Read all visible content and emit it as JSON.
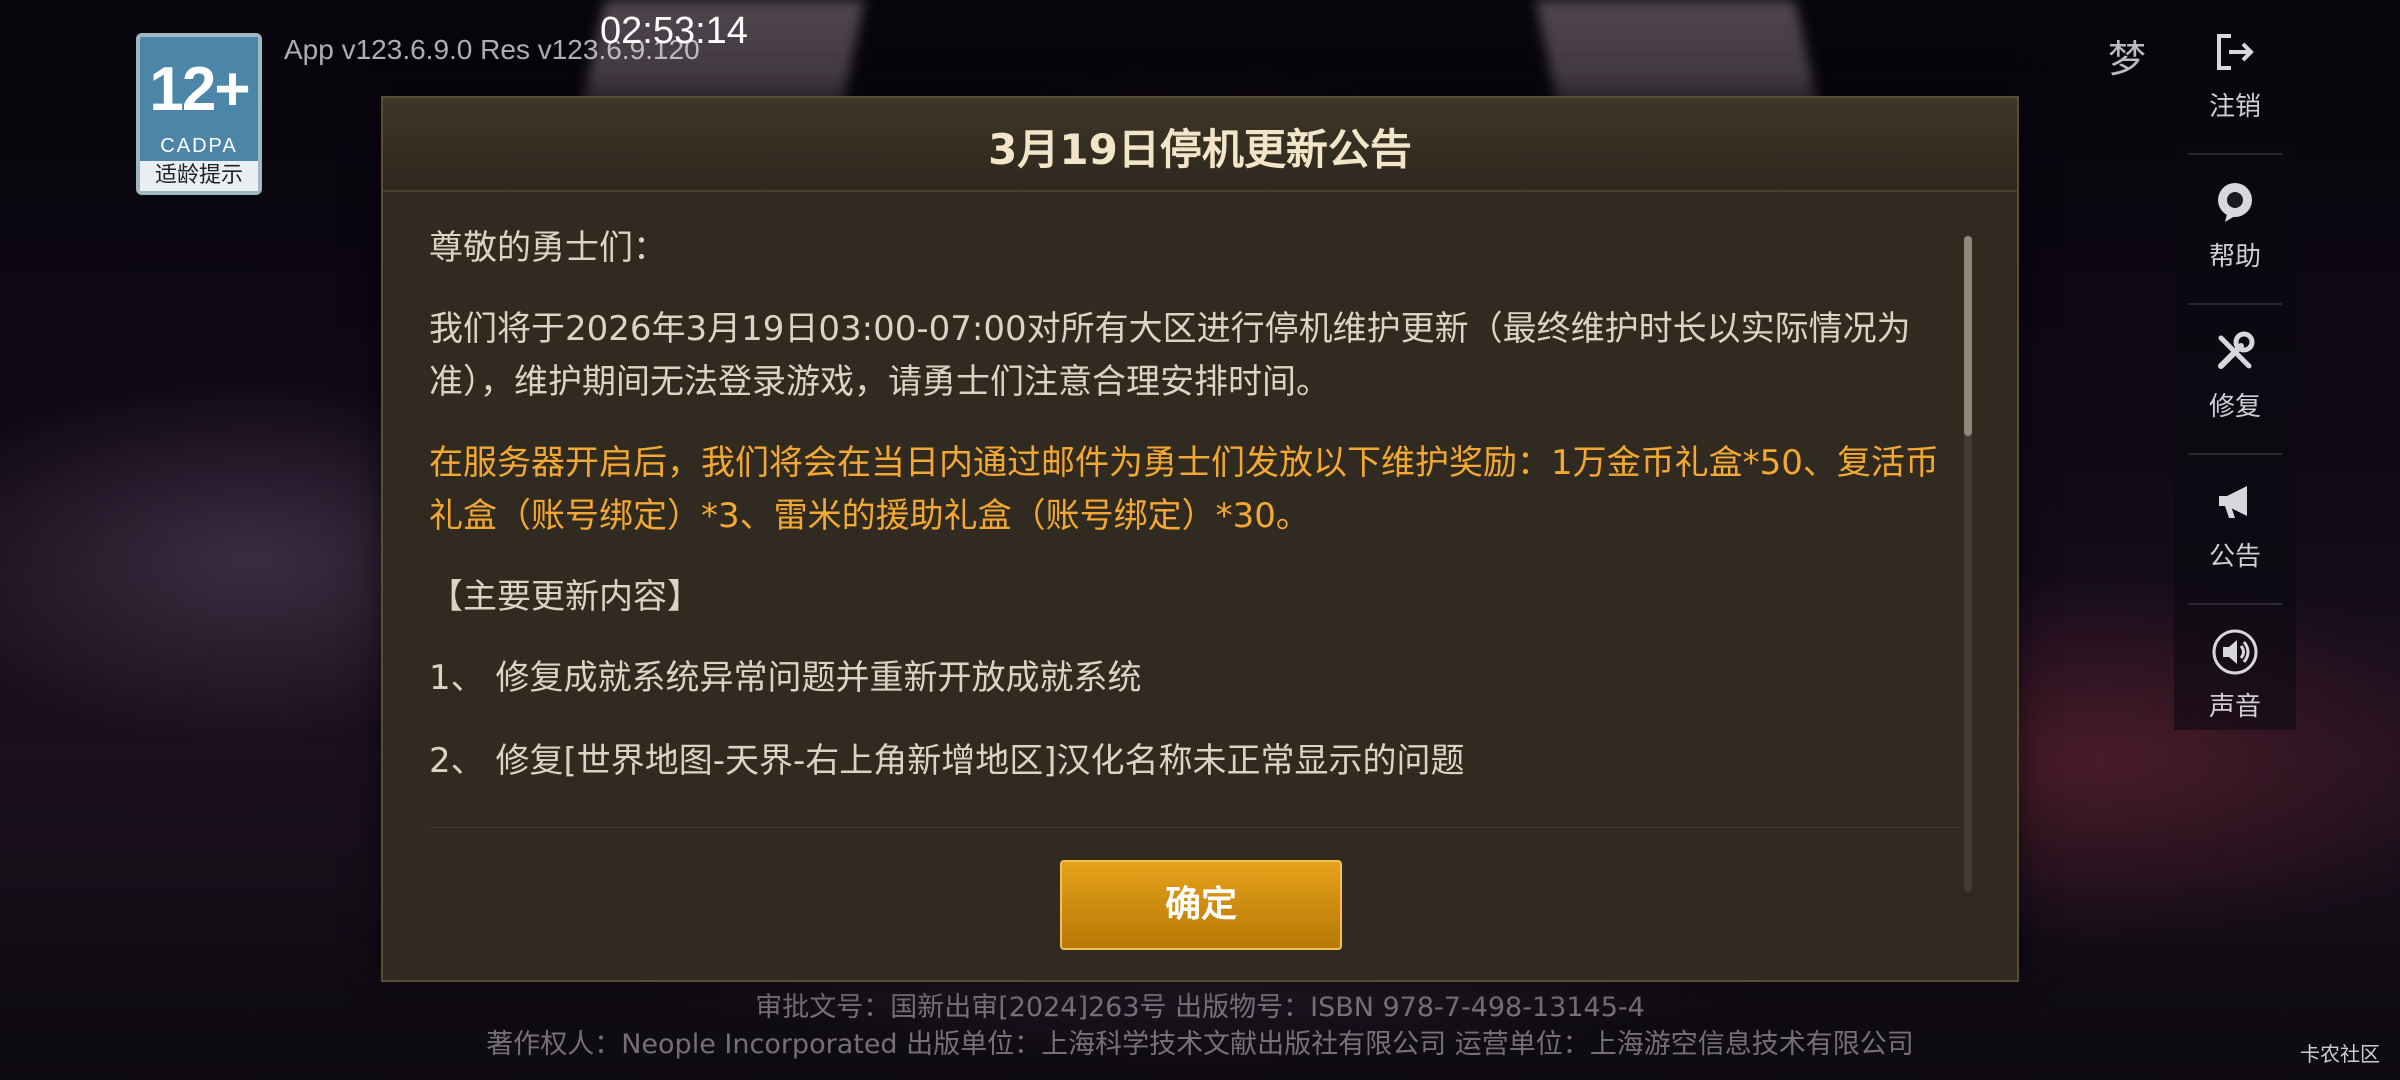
{
  "status": {
    "clock": "02:53:14"
  },
  "game": {
    "version": "App v123.6.9.0 Res v123.6.9.120",
    "age_rating": {
      "number": "12+",
      "org": "CADPA",
      "tip": "适龄提示"
    },
    "top_right_icon": "梦"
  },
  "sidebar": {
    "items": [
      {
        "label": "注销",
        "icon": "logout-icon"
      },
      {
        "label": "帮助",
        "icon": "help-icon"
      },
      {
        "label": "修复",
        "icon": "repair-icon"
      },
      {
        "label": "公告",
        "icon": "announcement-icon"
      },
      {
        "label": "声音",
        "icon": "sound-icon"
      }
    ]
  },
  "dialog": {
    "title": "3月19日停机更新公告",
    "greeting": "尊敬的勇士们：",
    "body": "我们将于2026年3月19日03:00-07:00对所有大区进行停机维护更新（最终维护时长以实际情况为准），维护期间无法登录游戏，请勇士们注意合理安排时间。",
    "reward": "在服务器开启后，我们将会在当日内通过邮件为勇士们发放以下维护奖励：1万金币礼盒*50、复活币礼盒（账号绑定）*3、雷米的援助礼盒（账号绑定）*30。",
    "section_title": "【主要更新内容】",
    "items": [
      "1、 修复成就系统异常问题并重新开放成就系统",
      "2、 修复[世界地图-天界-右上角新增地区]汉化名称未正常显示的问题"
    ],
    "confirm_label": "确定"
  },
  "footer": {
    "line1": "审批文号：国新出审[2024]263号 出版物号：ISBN 978-7-498-13145-4",
    "line2": "著作权人：Neople Incorporated 出版单位：上海科学技术文献出版社有限公司 运营单位：上海游空信息技术有限公司"
  },
  "watermark": "卡农社区",
  "colors": {
    "accent": "#d9920f",
    "reward_text": "#f2a832",
    "dialog_bg": "#302a21"
  }
}
